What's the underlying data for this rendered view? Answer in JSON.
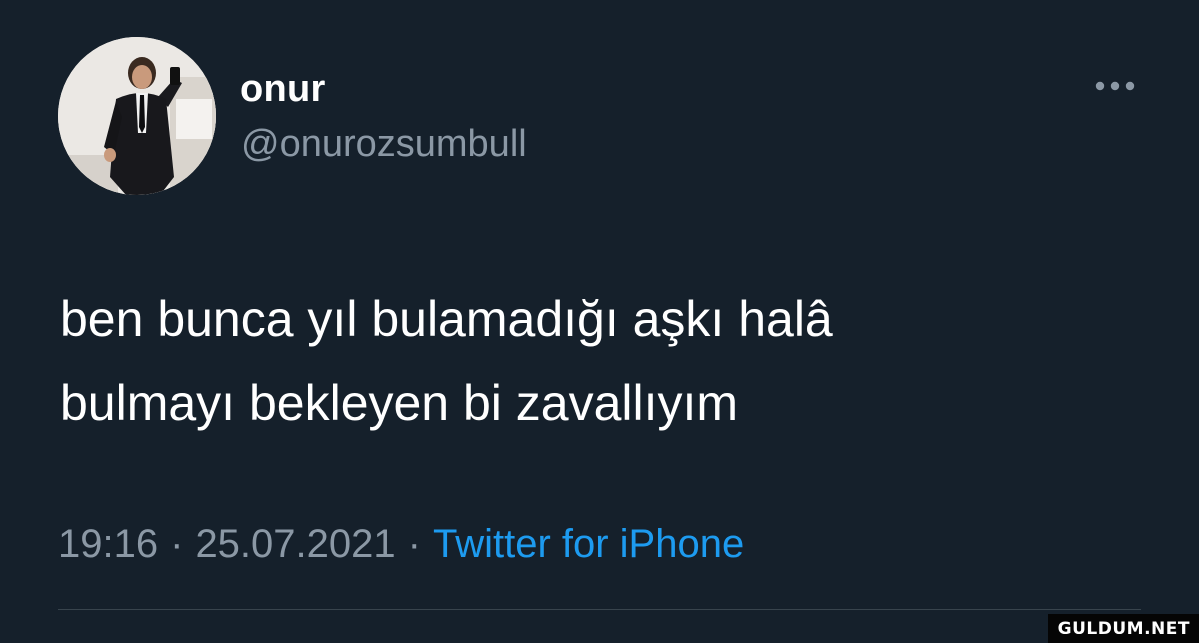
{
  "tweet": {
    "author": {
      "display_name": "onur",
      "handle": "@onurozsumbull",
      "avatar": "profile-photo"
    },
    "more_icon": "ellipsis-icon",
    "text_lines": [
      "ben bunca yıl bulamadığı aşkı halâ",
      "bulmayı bekleyen bi zavallıyım"
    ],
    "time": "19:16",
    "date": "25.07.2021",
    "separator": "·",
    "source": "Twitter for iPhone"
  },
  "watermark": "GULDUM.NET",
  "colors": {
    "background": "#15202b",
    "primary_text": "#ffffff",
    "secondary_text": "#8b98a5",
    "link": "#1d9bf0",
    "divider": "#38444d"
  }
}
